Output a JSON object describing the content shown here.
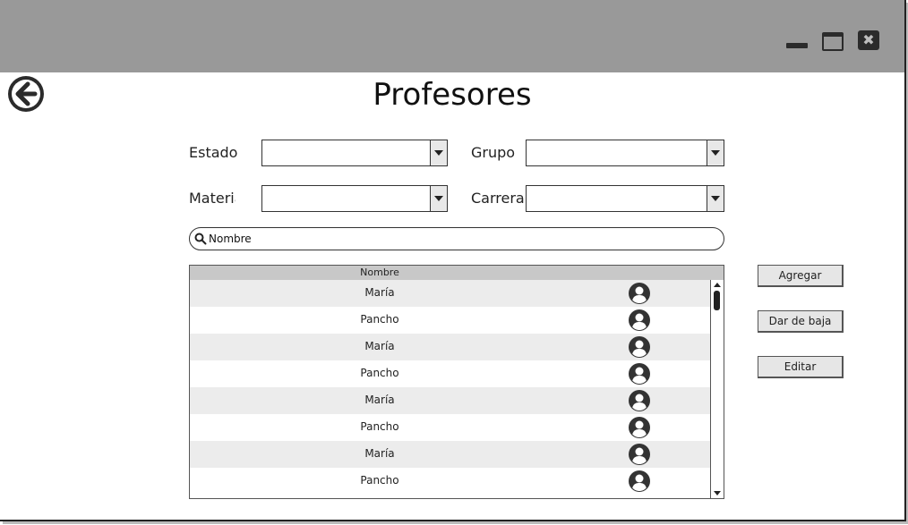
{
  "window": {
    "controls": {
      "minimize": "minimize-icon",
      "maximize": "maximize-icon",
      "close": "close-icon",
      "close_glyph": "✖"
    }
  },
  "back_icon": "arrow-left-circle-icon",
  "page": {
    "title": "Profesores"
  },
  "filters": {
    "estado": {
      "label": "Estado",
      "value": ""
    },
    "grupo": {
      "label": "Grupo",
      "value": ""
    },
    "materia": {
      "label": "Materia",
      "value": ""
    },
    "carrera": {
      "label": "Carrera",
      "value": ""
    }
  },
  "search": {
    "placeholder": "Nombre",
    "value": ""
  },
  "table": {
    "columns": [
      "Nombre"
    ],
    "rows": [
      {
        "name": "María",
        "icon": "user-icon"
      },
      {
        "name": "Pancho",
        "icon": "user-icon"
      },
      {
        "name": "María",
        "icon": "user-icon"
      },
      {
        "name": "Pancho",
        "icon": "user-icon"
      },
      {
        "name": "María",
        "icon": "user-icon"
      },
      {
        "name": "Pancho",
        "icon": "user-icon"
      },
      {
        "name": "María",
        "icon": "user-icon"
      },
      {
        "name": "Pancho",
        "icon": "user-icon"
      }
    ]
  },
  "actions": {
    "add": "Agregar",
    "remove": "Dar de baja",
    "edit": "Editar"
  },
  "colors": {
    "titlebar": "#999999",
    "row_alt": "#ececec",
    "header": "#c8c8c8",
    "icon_dark": "#2b2b2b"
  }
}
